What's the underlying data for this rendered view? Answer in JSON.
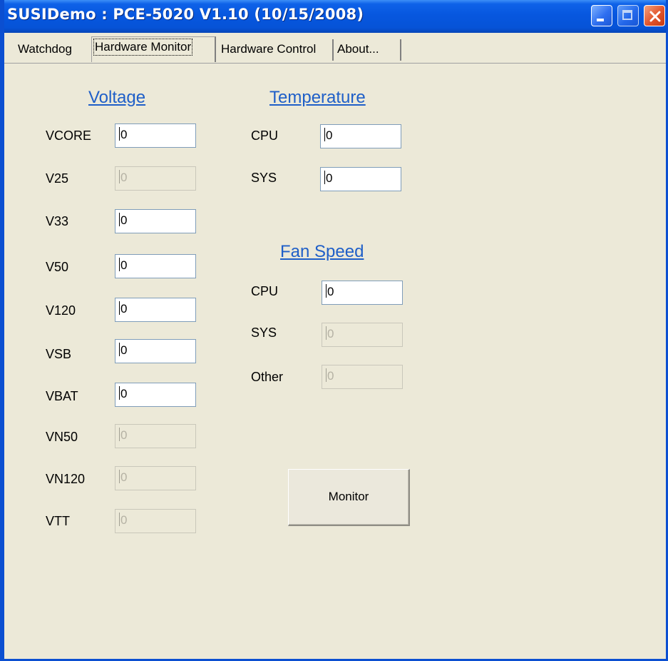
{
  "window": {
    "title": "SUSIDemo : PCE-5020 V1.10 (10/15/2008)",
    "titlebar_color": "#0757df",
    "controls": [
      {
        "name": "minimize",
        "icon": "minimize-icon"
      },
      {
        "name": "maximize",
        "icon": "maximize-icon",
        "disabled": true
      },
      {
        "name": "close",
        "icon": "close-icon"
      }
    ]
  },
  "tabs": [
    {
      "label": "Watchdog",
      "selected": false
    },
    {
      "label": "Hardware Monitor",
      "selected": true
    },
    {
      "label": "Hardware Control",
      "selected": false
    },
    {
      "label": "About...",
      "selected": false
    }
  ],
  "voltage": {
    "title": "Voltage",
    "fields": [
      {
        "label": "VCORE",
        "value": "0",
        "enabled": true
      },
      {
        "label": "V25",
        "value": "0",
        "enabled": false
      },
      {
        "label": "V33",
        "value": "0",
        "enabled": true
      },
      {
        "label": "V50",
        "value": "0",
        "enabled": true
      },
      {
        "label": "V120",
        "value": "0",
        "enabled": true
      },
      {
        "label": "VSB",
        "value": "0",
        "enabled": true
      },
      {
        "label": "VBAT",
        "value": "0",
        "enabled": true
      },
      {
        "label": "VN50",
        "value": "0",
        "enabled": false
      },
      {
        "label": "VN120",
        "value": "0",
        "enabled": false
      },
      {
        "label": "VTT",
        "value": "0",
        "enabled": false
      }
    ]
  },
  "temperature": {
    "title": "Temperature",
    "fields": [
      {
        "label": "CPU",
        "value": "0",
        "enabled": true
      },
      {
        "label": "SYS",
        "value": "0",
        "enabled": true
      }
    ]
  },
  "fan_speed": {
    "title": "Fan Speed",
    "fields": [
      {
        "label": "CPU",
        "value": "0",
        "enabled": true
      },
      {
        "label": "SYS",
        "value": "0",
        "enabled": false
      },
      {
        "label": "Other",
        "value": "0",
        "enabled": false
      }
    ]
  },
  "monitor_button": {
    "label": "Monitor"
  },
  "colors": {
    "section_title": "#1f5fc8",
    "background": "#ece9d8",
    "field_border": "#7f9db9"
  }
}
